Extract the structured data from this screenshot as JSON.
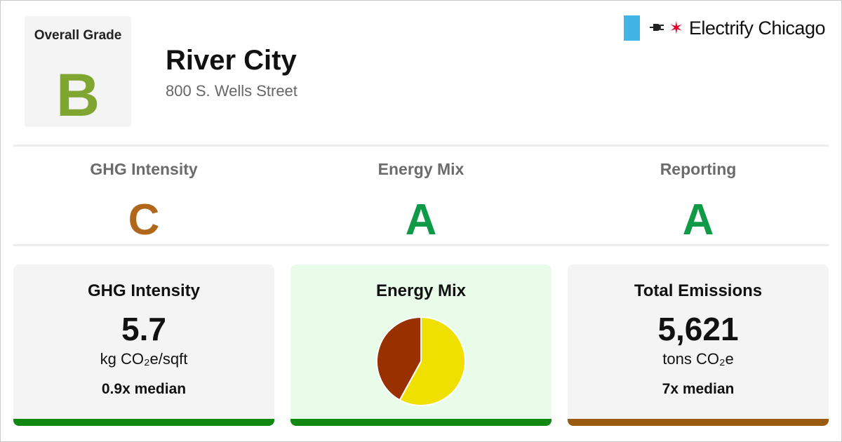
{
  "overall": {
    "label": "Overall Grade",
    "grade": "B",
    "color": "#7fa630"
  },
  "building": {
    "name": "River City",
    "address": "800 S. Wells Street"
  },
  "brand": {
    "name": "Electrify Chicago",
    "flag_color": "#41b6e6",
    "star_color": "#e4002b",
    "icons": [
      "plug-icon",
      "star-icon"
    ]
  },
  "categories": [
    {
      "name": "GHG Intensity",
      "grade": "C",
      "color": "#b0671a"
    },
    {
      "name": "Energy Mix",
      "grade": "A",
      "color": "#0f9a48"
    },
    {
      "name": "Reporting",
      "grade": "A",
      "color": "#0f9a48"
    }
  ],
  "cards": {
    "ghg": {
      "title": "GHG Intensity",
      "value": "5.7",
      "unit": "kg CO₂e/sqft",
      "median": "0.9x median",
      "bar_color": "#118811"
    },
    "mix": {
      "title": "Energy Mix",
      "bar_color": "#118811",
      "background": "#e9fce9"
    },
    "total": {
      "title": "Total Emissions",
      "value": "5,621",
      "unit": "tons CO₂e",
      "median": "7x median",
      "bar_color": "#9a5a10"
    }
  },
  "chart_data": {
    "type": "pie",
    "values": [
      58,
      42
    ],
    "colors": [
      "#f0e000",
      "#993000"
    ]
  }
}
